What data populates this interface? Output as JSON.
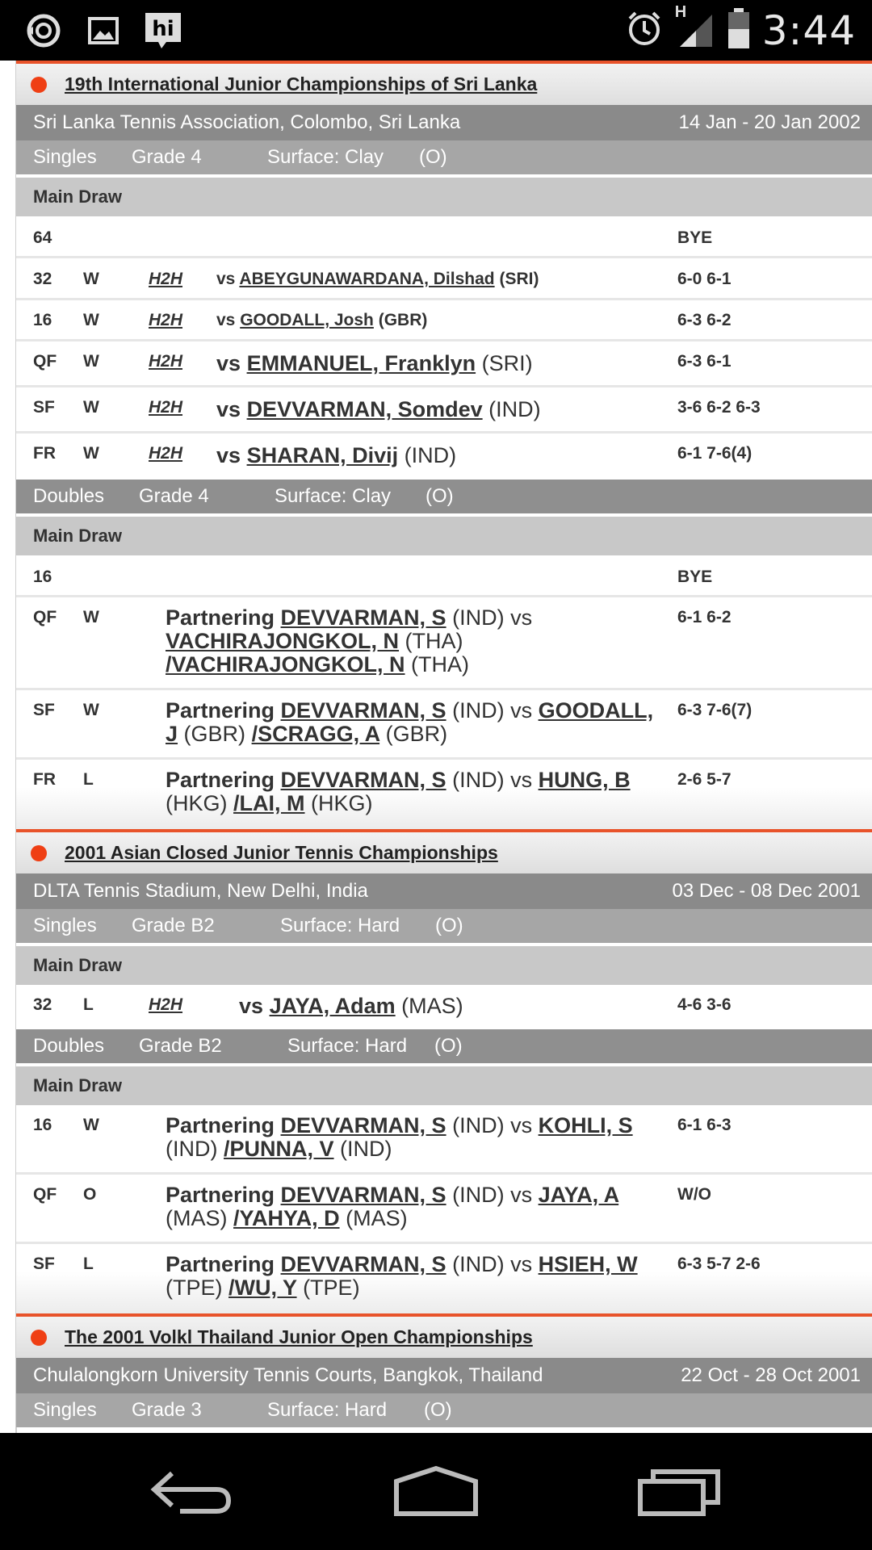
{
  "status_bar": {
    "left_icons": [
      "sync-icon",
      "image-icon",
      "hi-app-icon"
    ],
    "hi_text": "hi",
    "network_label": "H",
    "time": "3:44"
  },
  "tournaments": [
    {
      "name": "19th International Junior Championships of Sri Lanka",
      "venue": "Sri Lanka Tennis Association, Colombo, Sri Lanka",
      "dates": "14 Jan - 20 Jan 2002",
      "singles": {
        "event": "Singles",
        "grade": "Grade 4",
        "surface": "Surface: Clay",
        "io": "(O)",
        "draw": "Main Draw",
        "bye_round": "64",
        "bye": "BYE",
        "matches": [
          {
            "round": "32",
            "result": "W",
            "h2h": "H2H",
            "vs": "vs",
            "opponent": "ABEYGUNAWARDANA, Dilshad",
            "country": "(SRI)",
            "score": "6-0 6-1"
          },
          {
            "round": "16",
            "result": "W",
            "h2h": "H2H",
            "vs": "vs",
            "opponent": "GOODALL, Josh",
            "country": "(GBR)",
            "score": "6-3 6-2"
          },
          {
            "round": "QF",
            "result": "W",
            "h2h": "H2H",
            "vs": "vs",
            "opponent": "EMMANUEL, Franklyn",
            "country": "(SRI)",
            "score": "6-3 6-1"
          },
          {
            "round": "SF",
            "result": "W",
            "h2h": "H2H",
            "vs": "vs",
            "opponent": "DEVVARMAN, Somdev",
            "country": "(IND)",
            "score": "3-6 6-2 6-3"
          },
          {
            "round": "FR",
            "result": "W",
            "h2h": "H2H",
            "vs": "vs",
            "opponent": "SHARAN, Divij",
            "country": "(IND)",
            "score": "6-1 7-6(4)"
          }
        ]
      },
      "doubles": {
        "event": "Doubles",
        "grade": "Grade 4",
        "surface": "Surface: Clay",
        "io": "(O)",
        "draw": "Main Draw",
        "bye_round": "16",
        "bye": "BYE",
        "matches": [
          {
            "round": "QF",
            "result": "W",
            "partnering": "Partnering",
            "partner": "DEVVARMAN, S",
            "partner_country": "(IND) vs",
            "opp1": "VACHIRAJONGKOL, N",
            "opp1_country": "(THA)",
            "opp2": "/VACHIRAJONGKOL, N",
            "opp2_country": "(THA)",
            "score": "6-1 6-2"
          },
          {
            "round": "SF",
            "result": "W",
            "partnering": "Partnering",
            "partner": "DEVVARMAN, S",
            "partner_country": "(IND) vs",
            "opp1": "GOODALL, J",
            "opp1_country": "(GBR)",
            "opp2": "/SCRAGG, A",
            "opp2_country": "(GBR)",
            "score": "6-3 7-6(7)"
          },
          {
            "round": "FR",
            "result": "L",
            "partnering": "Partnering",
            "partner": "DEVVARMAN, S",
            "partner_country": "(IND) vs",
            "opp1": "HUNG, B",
            "opp1_country": "(HKG)",
            "opp2": "/LAI, M",
            "opp2_country": "(HKG)",
            "score": "2-6 5-7"
          }
        ]
      }
    },
    {
      "name": "2001 Asian Closed Junior Tennis Championships",
      "venue": "DLTA Tennis Stadium, New Delhi, India",
      "dates": "03 Dec - 08 Dec 2001",
      "singles": {
        "event": "Singles",
        "grade": "Grade B2",
        "surface": "Surface: Hard",
        "io": "(O)",
        "draw": "Main Draw",
        "matches": [
          {
            "round": "32",
            "result": "L",
            "h2h": "H2H",
            "vs": "vs",
            "opponent": "JAYA, Adam",
            "country": "(MAS)",
            "score": "4-6 3-6"
          }
        ]
      },
      "doubles": {
        "event": "Doubles",
        "grade": "Grade B2",
        "surface": "Surface: Hard",
        "io": "(O)",
        "draw": "Main Draw",
        "matches": [
          {
            "round": "16",
            "result": "W",
            "partnering": "Partnering",
            "partner": "DEVVARMAN, S",
            "partner_country": "(IND) vs",
            "opp1": "KOHLI, S",
            "opp1_country": "(IND)",
            "opp2": "/PUNNA, V",
            "opp2_country": "(IND)",
            "score": "6-1 6-3"
          },
          {
            "round": "QF",
            "result": "O",
            "partnering": "Partnering",
            "partner": "DEVVARMAN, S",
            "partner_country": "(IND) vs",
            "opp1": "JAYA, A",
            "opp1_country": "(MAS)",
            "opp2": "/YAHYA, D",
            "opp2_country": "(MAS)",
            "score": "W/O"
          },
          {
            "round": "SF",
            "result": "L",
            "partnering": "Partnering",
            "partner": "DEVVARMAN, S",
            "partner_country": "(IND) vs",
            "opp1": "HSIEH, W",
            "opp1_country": "(TPE)",
            "opp2": "/WU, Y",
            "opp2_country": "(TPE)",
            "score": "6-3 5-7 2-6"
          }
        ]
      }
    },
    {
      "name": "The 2001 Volkl Thailand Junior Open Championships",
      "venue": "Chulalongkorn University Tennis Courts, Bangkok, Thailand",
      "dates": "22 Oct - 28 Oct 2001",
      "singles": {
        "event": "Singles",
        "grade": "Grade 3",
        "surface": "Surface: Hard",
        "io": "(O)"
      }
    }
  ],
  "nav_bar": {
    "buttons": [
      "back-icon",
      "home-icon",
      "recent-apps-icon"
    ]
  },
  "colors": {
    "accent": "#ef3f14",
    "venue_bar": "#8a8a8a",
    "event_bar": "#a6a6a6",
    "draw_bar": "#c8c8c8"
  }
}
